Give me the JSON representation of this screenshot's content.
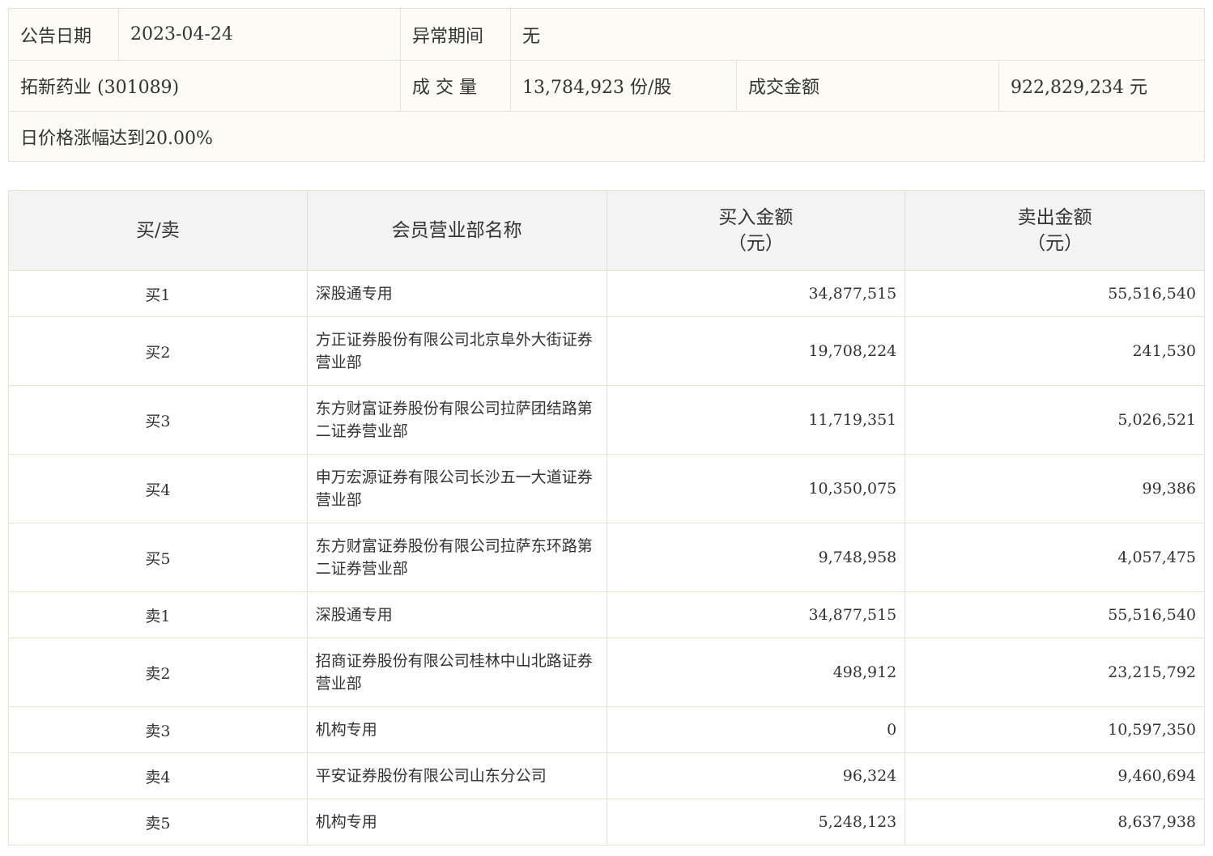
{
  "info": {
    "date_label": "公告日期",
    "date_value": "2023-04-24",
    "period_label": "异常期间",
    "period_value": "无",
    "stock_name": "拓新药业 (301089)",
    "volume_label": "成 交 量",
    "volume_value": "13,784,923 份/股",
    "amount_label": "成交金额",
    "amount_value": "922,829,234 元",
    "reason": "日价格涨幅达到20.00%"
  },
  "table": {
    "headers": {
      "side": "买/卖",
      "branch": "会员营业部名称",
      "buy_line1": "买入金额",
      "buy_line2": "（元）",
      "sell_line1": "卖出金额",
      "sell_line2": "（元）"
    },
    "rows": [
      {
        "side": "买1",
        "branch": "深股通专用",
        "buy": "34,877,515",
        "sell": "55,516,540"
      },
      {
        "side": "买2",
        "branch": "方正证券股份有限公司北京阜外大街证券营业部",
        "buy": "19,708,224",
        "sell": "241,530"
      },
      {
        "side": "买3",
        "branch": "东方财富证券股份有限公司拉萨团结路第二证券营业部",
        "buy": "11,719,351",
        "sell": "5,026,521"
      },
      {
        "side": "买4",
        "branch": "申万宏源证券有限公司长沙五一大道证券营业部",
        "buy": "10,350,075",
        "sell": "99,386"
      },
      {
        "side": "买5",
        "branch": "东方财富证券股份有限公司拉萨东环路第二证券营业部",
        "buy": "9,748,958",
        "sell": "4,057,475"
      },
      {
        "side": "卖1",
        "branch": "深股通专用",
        "buy": "34,877,515",
        "sell": "55,516,540"
      },
      {
        "side": "卖2",
        "branch": "招商证券股份有限公司桂林中山北路证券营业部",
        "buy": "498,912",
        "sell": "23,215,792"
      },
      {
        "side": "卖3",
        "branch": "机构专用",
        "buy": "0",
        "sell": "10,597,350"
      },
      {
        "side": "卖4",
        "branch": "平安证券股份有限公司山东分公司",
        "buy": "96,324",
        "sell": "9,460,694"
      },
      {
        "side": "卖5",
        "branch": "机构专用",
        "buy": "5,248,123",
        "sell": "8,637,938"
      }
    ]
  }
}
